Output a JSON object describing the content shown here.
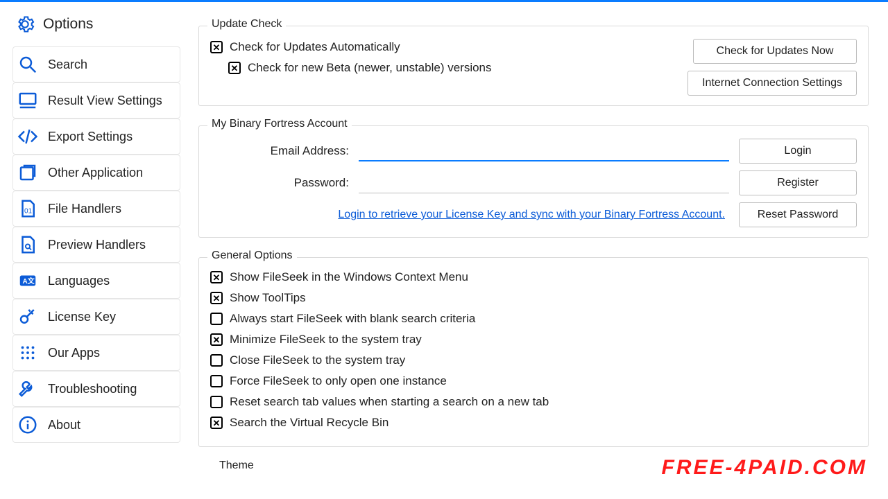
{
  "sidebar": {
    "header": "Options",
    "items": [
      {
        "label": "Search",
        "icon": "search-icon"
      },
      {
        "label": "Result View Settings",
        "icon": "monitor-icon"
      },
      {
        "label": "Export Settings",
        "icon": "code-icon"
      },
      {
        "label": "Other Application",
        "icon": "window-icon"
      },
      {
        "label": "File Handlers",
        "icon": "file-binary-icon"
      },
      {
        "label": "Preview Handlers",
        "icon": "file-search-icon"
      },
      {
        "label": "Languages",
        "icon": "language-icon"
      },
      {
        "label": "License Key",
        "icon": "key-icon"
      },
      {
        "label": "Our Apps",
        "icon": "grid-icon"
      },
      {
        "label": "Troubleshooting",
        "icon": "wrench-icon"
      },
      {
        "label": "About",
        "icon": "info-icon"
      }
    ]
  },
  "update": {
    "title": "Update Check",
    "auto_label": "Check for Updates Automatically",
    "beta_label": "Check for new Beta (newer, unstable) versions",
    "check_now_btn": "Check for Updates Now",
    "conn_btn": "Internet Connection Settings"
  },
  "account": {
    "title": "My Binary Fortress Account",
    "email_label": "Email Address:",
    "password_label": "Password:",
    "login_btn": "Login",
    "register_btn": "Register",
    "reset_btn": "Reset Password",
    "link_text": "Login to retrieve your License Key and sync with your Binary Fortress Account."
  },
  "general": {
    "title": "General Options",
    "opts": [
      {
        "label": "Show FileSeek in the Windows Context Menu",
        "checked": true
      },
      {
        "label": "Show ToolTips",
        "checked": true
      },
      {
        "label": "Always start FileSeek with blank search criteria",
        "checked": false
      },
      {
        "label": "Minimize FileSeek to the system tray",
        "checked": true
      },
      {
        "label": "Close FileSeek to the system tray",
        "checked": false
      },
      {
        "label": "Force FileSeek to only open one instance",
        "checked": false
      },
      {
        "label": "Reset search tab values when starting a search on a new tab",
        "checked": false
      },
      {
        "label": "Search the Virtual Recycle Bin",
        "checked": true
      }
    ]
  },
  "theme_title": "Theme",
  "watermark": "FREE-4PAID.COM"
}
